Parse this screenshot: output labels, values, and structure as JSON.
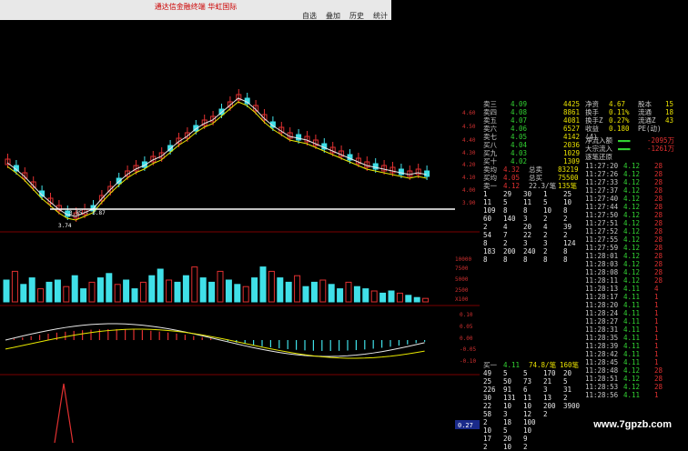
{
  "title_bar": {
    "title": "通达信金融终端  华虹国际",
    "menu": [
      "自选",
      "叠加",
      "历史",
      "统计"
    ]
  },
  "price_axis": [
    "4.60",
    "4.50",
    "4.40",
    "4.30",
    "4.20",
    "4.10",
    "4.00",
    "3.90"
  ],
  "volume_axis": [
    "10000",
    "7500",
    "5000",
    "2500",
    "X100"
  ],
  "macd_axis": [
    "0.10",
    "0.05",
    "0.00",
    "-0.05",
    "-0.10"
  ],
  "price_annotations": {
    "low_range": "3.85 - 3.87",
    "low_mark": "3.74"
  },
  "sub_panel_value": "0.27",
  "sell_orders": [
    {
      "label": "卖三",
      "price": "4.09",
      "volume": "4425"
    },
    {
      "label": "卖四",
      "price": "4.08",
      "volume": "8861"
    },
    {
      "label": "卖五",
      "price": "4.07",
      "volume": "4081"
    },
    {
      "label": "卖六",
      "price": "4.06",
      "volume": "6527"
    },
    {
      "label": "卖七",
      "price": "4.05",
      "volume": "4142"
    },
    {
      "label": "买八",
      "price": "4.04",
      "volume": "2036"
    },
    {
      "label": "买九",
      "price": "4.03",
      "volume": "1029"
    },
    {
      "label": "买十",
      "price": "4.02",
      "volume": "1309"
    }
  ],
  "stats": [
    {
      "label": "净资",
      "value": "4.67",
      "label2": "股本",
      "value2": "15"
    },
    {
      "label": "换手",
      "value": "0.11%",
      "label2": "流通",
      "value2": "18"
    },
    {
      "label": "换手Z",
      "value": "0.27%",
      "label2": "流通Z",
      "value2": "43"
    },
    {
      "label": "收益(4)",
      "value": "0.180",
      "label2": "PE(动)",
      "value2": ""
    }
  ],
  "fund_flow": [
    {
      "label": "净流入额",
      "value": "-2095万"
    },
    {
      "label": "大宗流入",
      "value": "-1261万"
    }
  ],
  "fund_flow_footer": "逐笔还原",
  "summary": [
    {
      "label": "卖均",
      "value": "4.32",
      "label2": "总卖",
      "value2": "83219"
    },
    {
      "label": "买均",
      "value": "4.05",
      "label2": "总买",
      "value2": "75500"
    },
    {
      "label": "卖一",
      "value": "4.12",
      "label2": "22.3/笔",
      "value2": "135笔"
    }
  ],
  "sell_one_queue": [
    [
      "1",
      "29",
      "30",
      "1",
      "25"
    ],
    [
      "11",
      "5",
      "11",
      "5",
      "10"
    ],
    [
      "109",
      "8",
      "8",
      "10",
      "8"
    ],
    [
      "60",
      "140",
      "3",
      "2",
      "2"
    ],
    [
      "2",
      "4",
      "20",
      "4",
      "39"
    ],
    [
      "54",
      "7",
      "22",
      "2",
      "2"
    ],
    [
      "8",
      "2",
      "3",
      "3",
      "124"
    ],
    [
      "183",
      "200",
      "240",
      "2",
      "8"
    ],
    [
      "8",
      "8",
      "8",
      "8",
      "8"
    ]
  ],
  "buy_one": {
    "label": "买一",
    "price": "4.11",
    "avg": "74.8/笔",
    "count": "160笔"
  },
  "buy_one_queue": [
    [
      "49",
      "5",
      "5",
      "170",
      "20"
    ],
    [
      "25",
      "50",
      "73",
      "21",
      "5"
    ],
    [
      "226",
      "91",
      "6",
      "3",
      "31"
    ],
    [
      "30",
      "131",
      "11",
      "13",
      "2"
    ],
    [
      "22",
      "10",
      "10",
      "200",
      "3900"
    ],
    [
      "58",
      "3",
      "12",
      "2",
      ""
    ],
    [
      "2",
      "18",
      "100",
      "",
      ""
    ],
    [
      "10",
      "5",
      "10",
      "",
      ""
    ],
    [
      "17",
      "20",
      "9",
      "",
      ""
    ],
    [
      "2",
      "10",
      "2",
      "",
      ""
    ]
  ],
  "ticks": [
    {
      "time": "11:27:20",
      "price": "4.12",
      "vol": "28"
    },
    {
      "time": "11:27:26",
      "price": "4.12",
      "vol": "28"
    },
    {
      "time": "11:27:33",
      "price": "4.12",
      "vol": "28"
    },
    {
      "time": "11:27:37",
      "price": "4.12",
      "vol": "28"
    },
    {
      "time": "11:27:40",
      "price": "4.12",
      "vol": "28"
    },
    {
      "time": "11:27:44",
      "price": "4.12",
      "vol": "28"
    },
    {
      "time": "11:27:50",
      "price": "4.12",
      "vol": "28"
    },
    {
      "time": "11:27:51",
      "price": "4.12",
      "vol": "28"
    },
    {
      "time": "11:27:52",
      "price": "4.12",
      "vol": "28"
    },
    {
      "time": "11:27:55",
      "price": "4.12",
      "vol": "28"
    },
    {
      "time": "11:27:59",
      "price": "4.12",
      "vol": "28"
    },
    {
      "time": "11:28:01",
      "price": "4.12",
      "vol": "28"
    },
    {
      "time": "11:28:03",
      "price": "4.12",
      "vol": "28"
    },
    {
      "time": "11:28:08",
      "price": "4.12",
      "vol": "28"
    },
    {
      "time": "11:28:11",
      "price": "4.12",
      "vol": "28"
    },
    {
      "time": "11:28:13",
      "price": "4.11",
      "vol": "4"
    },
    {
      "time": "11:28:17",
      "price": "4.11",
      "vol": "1"
    },
    {
      "time": "11:28:20",
      "price": "4.11",
      "vol": "1"
    },
    {
      "time": "11:28:24",
      "price": "4.11",
      "vol": "1"
    },
    {
      "time": "11:28:27",
      "price": "4.11",
      "vol": "1"
    },
    {
      "time": "11:28:31",
      "price": "4.11",
      "vol": "1"
    },
    {
      "time": "11:28:35",
      "price": "4.11",
      "vol": "1"
    },
    {
      "time": "11:28:39",
      "price": "4.11",
      "vol": "1"
    },
    {
      "time": "11:28:42",
      "price": "4.11",
      "vol": "1"
    },
    {
      "time": "11:28:45",
      "price": "4.11",
      "vol": "1"
    },
    {
      "time": "11:28:48",
      "price": "4.12",
      "vol": "28"
    },
    {
      "time": "11:28:51",
      "price": "4.12",
      "vol": "28"
    },
    {
      "time": "11:28:53",
      "price": "4.12",
      "vol": "28"
    },
    {
      "time": "11:28:56",
      "price": "4.11",
      "vol": "1"
    }
  ],
  "website": "www.7gpzb.com"
}
